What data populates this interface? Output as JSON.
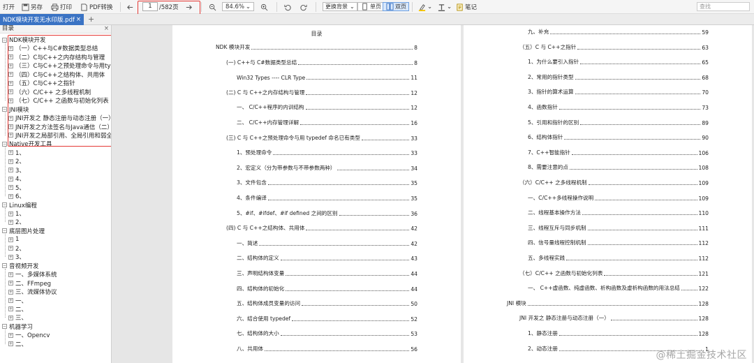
{
  "toolbar": {
    "open": "打开",
    "save_as": "另存",
    "print": "打印",
    "pdf_convert": "PDF转换",
    "page_current": "1",
    "page_total": "/582页",
    "zoom": "84.6%",
    "bg_label": "更换背景",
    "single": "单页",
    "double": "双页",
    "notes": "笔记",
    "search_placeholder": "查找",
    "accent": "#3a73c4",
    "highlight": "#e53935"
  },
  "tab": {
    "title": "NDK模块开发无水印版.pdf",
    "close": "×",
    "add": "+"
  },
  "sidebar": {
    "title": "目录",
    "close": "×",
    "tree": [
      {
        "label": "NDK模块开发",
        "level": 0
      },
      {
        "label": "（一）C++与C#数据类型总结",
        "level": 1
      },
      {
        "label": "（二）C与C++之内存结构与管理",
        "level": 1
      },
      {
        "label": "（三）C与C++之预处理命令与用typedef",
        "level": 1
      },
      {
        "label": "（四）C与C++之结构体、共用体",
        "level": 1
      },
      {
        "label": "（五）C与C++之指针",
        "level": 1
      },
      {
        "label": "（六）C/C++ 之多线程机制",
        "level": 1
      },
      {
        "label": "（七）C/C++ 之函数与初始化列表",
        "level": 1
      },
      {
        "label": "JNI模块",
        "level": 0
      },
      {
        "label": "JNI开发之 静态注册与动态注册（一）",
        "level": 1
      },
      {
        "label": "JNI开发之方法签名与Java通信（二）",
        "level": 1
      },
      {
        "label": "JNI开发之局部引用、全局引用和弱全局引用",
        "level": 1
      },
      {
        "label": "Native开发工具",
        "level": 0
      },
      {
        "label": "1、",
        "level": 1
      },
      {
        "label": "2、",
        "level": 1
      },
      {
        "label": "3、",
        "level": 1
      },
      {
        "label": "4、",
        "level": 1
      },
      {
        "label": "5、",
        "level": 1
      },
      {
        "label": "6、",
        "level": 1
      },
      {
        "label": "Linux编程",
        "level": 0
      },
      {
        "label": "1、",
        "level": 1
      },
      {
        "label": "2、",
        "level": 1
      },
      {
        "label": "底层图片处理",
        "level": 0
      },
      {
        "label": "1",
        "level": 1
      },
      {
        "label": "2、",
        "level": 1
      },
      {
        "label": "3、",
        "level": 1
      },
      {
        "label": "音视频开发",
        "level": 0
      },
      {
        "label": "一、多媒体系统",
        "level": 1
      },
      {
        "label": "二、FFmpeg",
        "level": 1
      },
      {
        "label": "三、流媒体协议",
        "level": 1
      },
      {
        "label": "一、",
        "level": 1
      },
      {
        "label": "二、",
        "level": 1
      },
      {
        "label": "三、",
        "level": 1
      },
      {
        "label": "机器学习",
        "level": 0
      },
      {
        "label": "一、Opencv",
        "level": 1
      },
      {
        "label": "二、",
        "level": 1
      }
    ]
  },
  "doc": {
    "page1_title": "目录",
    "page1": [
      {
        "text": "NDK 模块开发",
        "page": "8",
        "indent": 0
      },
      {
        "text": "(一) C++与 C#数据类型总结",
        "page": "8",
        "indent": 1
      },
      {
        "text": "Win32 Types ---- CLR Type",
        "page": "11",
        "indent": 2
      },
      {
        "text": "(二) C 与 C++之内存结构与管理",
        "page": "12",
        "indent": 1
      },
      {
        "text": "一、 C/C++程序的内训结构",
        "page": "12",
        "indent": 2
      },
      {
        "text": "二、 C/C++内存管理详解",
        "page": "16",
        "indent": 2
      },
      {
        "text": "(三) C 与 C++之预处理命令与用 typedef 命名已有类型",
        "page": "33",
        "indent": 1
      },
      {
        "text": "1、预处理命令",
        "page": "33",
        "indent": 2
      },
      {
        "text": "2、宏定义（分为带参数与不带参数两种）",
        "page": "34",
        "indent": 2
      },
      {
        "text": "3、文件包含",
        "page": "35",
        "indent": 2
      },
      {
        "text": "4、条件编译",
        "page": "35",
        "indent": 2
      },
      {
        "text": "5、#if、#ifdef、#if defined 之间的区别",
        "page": "36",
        "indent": 2
      },
      {
        "text": "(四) C 与 C++之结构体、共用体",
        "page": "42",
        "indent": 1
      },
      {
        "text": "一、简述",
        "page": "42",
        "indent": 2
      },
      {
        "text": "二、结构体的定义",
        "page": "43",
        "indent": 2
      },
      {
        "text": "三、声明结构体变量",
        "page": "44",
        "indent": 2
      },
      {
        "text": "四、结构体的初始化",
        "page": "44",
        "indent": 2
      },
      {
        "text": "五、结构体成员变量的访问",
        "page": "50",
        "indent": 2
      },
      {
        "text": "六、结合使用 typedef",
        "page": "52",
        "indent": 2
      },
      {
        "text": "七、结构体的大小",
        "page": "53",
        "indent": 2
      },
      {
        "text": "八、共用体",
        "page": "56",
        "indent": 2
      }
    ],
    "page2": [
      {
        "text": "九、补充",
        "page": "59",
        "indent": 2
      },
      {
        "text": "（五）C 与 C++之指针",
        "page": "63",
        "indent": 1
      },
      {
        "text": "1、为什么要引入指针",
        "page": "65",
        "indent": 2
      },
      {
        "text": "2、常用的指针类型",
        "page": "68",
        "indent": 2
      },
      {
        "text": "3、指针的算术运算",
        "page": "70",
        "indent": 2
      },
      {
        "text": "4、函数指针",
        "page": "73",
        "indent": 2
      },
      {
        "text": "5、引用和指针的区别",
        "page": "89",
        "indent": 2
      },
      {
        "text": "6、结构体指针",
        "page": "90",
        "indent": 2
      },
      {
        "text": "7、C++智能指针",
        "page": "106",
        "indent": 2
      },
      {
        "text": "8、需要注意的点",
        "page": "108",
        "indent": 2
      },
      {
        "text": "（六）C/C++ 之多线程机制",
        "page": "109",
        "indent": 1
      },
      {
        "text": "一、C/C++多线程操作说明",
        "page": "109",
        "indent": 2
      },
      {
        "text": "二、线程基本操作方法",
        "page": "110",
        "indent": 2
      },
      {
        "text": "三、线程互斥与同步机制",
        "page": "111",
        "indent": 2
      },
      {
        "text": "四、信号量线程控制机制",
        "page": "112",
        "indent": 2
      },
      {
        "text": "五、多线程实践",
        "page": "112",
        "indent": 2
      },
      {
        "text": "（七）C/C++ 之函数与初始化列表",
        "page": "121",
        "indent": 1
      },
      {
        "text": "一、 C++虚函数、纯虚函数、析构函数及虚析构函数的用法总结",
        "page": "122",
        "indent": 2
      },
      {
        "text": "JNI 模块",
        "page": "128",
        "indent": 0
      },
      {
        "text": "JNI 开发之 静态注册与动态注册（一）",
        "page": "128",
        "indent": 1
      },
      {
        "text": "1、静态注册",
        "page": "128",
        "indent": 2
      },
      {
        "text": "2、动态注册",
        "page": "1",
        "indent": 2
      }
    ],
    "watermark": "@稀土掘金技术社区"
  }
}
